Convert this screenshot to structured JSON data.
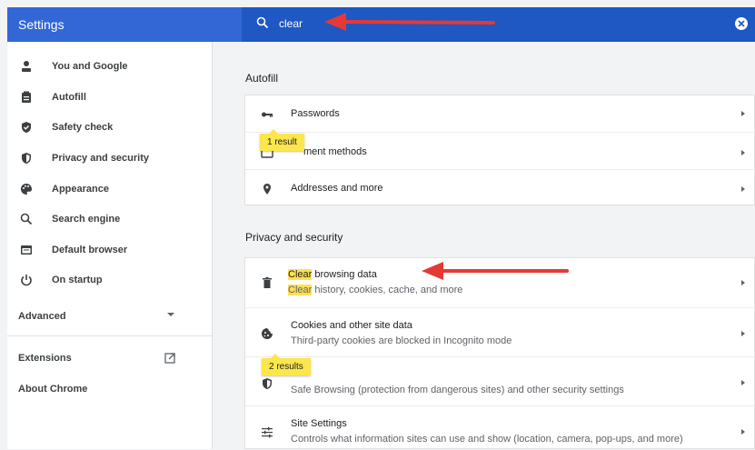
{
  "header": {
    "title": "Settings",
    "search_value": "clear"
  },
  "sidebar": {
    "items": [
      {
        "label": "You and Google",
        "icon": "person-icon"
      },
      {
        "label": "Autofill",
        "icon": "clipboard-icon"
      },
      {
        "label": "Safety check",
        "icon": "shield-check-icon"
      },
      {
        "label": "Privacy and security",
        "icon": "shield-icon"
      },
      {
        "label": "Appearance",
        "icon": "palette-icon"
      },
      {
        "label": "Search engine",
        "icon": "search-icon"
      },
      {
        "label": "Default browser",
        "icon": "browser-icon"
      },
      {
        "label": "On startup",
        "icon": "power-icon"
      }
    ],
    "advanced": "Advanced",
    "extensions": "Extensions",
    "about": "About Chrome"
  },
  "autofill": {
    "section_title": "Autofill",
    "rows": [
      {
        "title": "Passwords",
        "icon": "key-icon"
      },
      {
        "title": "Payment methods",
        "icon": "card-icon"
      },
      {
        "title": "Addresses and more",
        "icon": "location-pin-icon"
      }
    ],
    "bubble": "1 result",
    "payment_visible": "ment methods"
  },
  "privacy": {
    "section_title": "Privacy and security",
    "rows": [
      {
        "title_hl": "Clear",
        "title_rest": " browsing data",
        "sub_hl": "Clear",
        "sub_rest": " history, cookies, cache, and more",
        "icon": "trash-icon"
      },
      {
        "title": "Cookies and other site data",
        "sub": "Third-party cookies are blocked in Incognito mode",
        "icon": "cookie-icon"
      },
      {
        "title": "Security",
        "sub": "Safe Browsing (protection from dangerous sites) and other security settings",
        "icon": "shield-icon"
      },
      {
        "title": "Site Settings",
        "sub": "Controls what information sites can use and show (location, camera, pop-ups, and more)",
        "icon": "sliders-icon"
      }
    ],
    "bubble": "2 results"
  },
  "colors": {
    "header": "#3367d6",
    "search_bar": "#1f57c3",
    "highlight": "#fde050",
    "bubble": "#fbe64c",
    "annotation_arrow": "#e53935"
  }
}
